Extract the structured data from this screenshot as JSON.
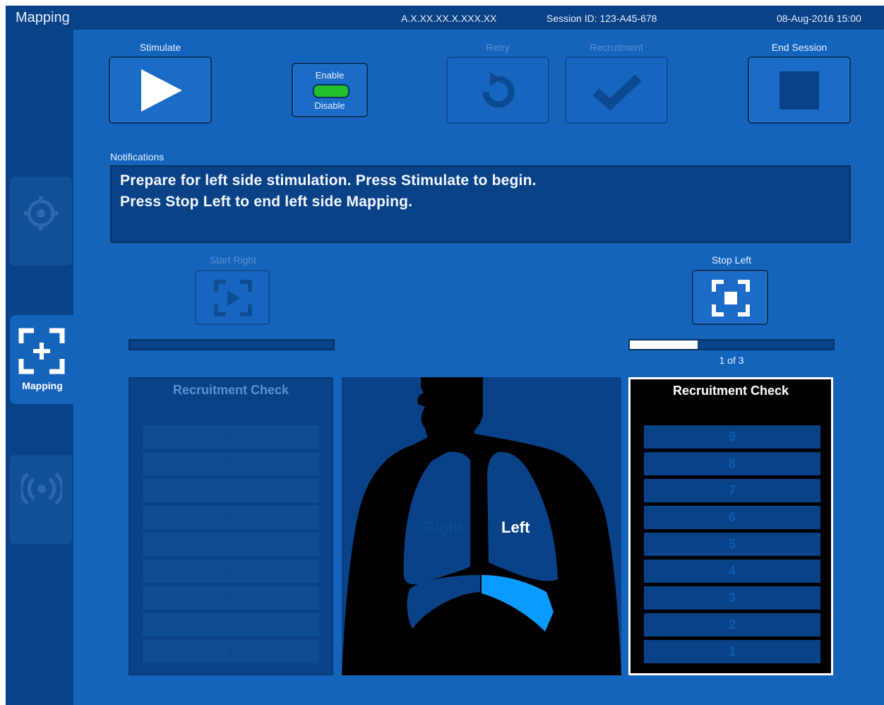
{
  "header": {
    "title": "Mapping",
    "device_id": "A.X.XX.XX.X.XXX.XX",
    "session": "Session ID: 123-A45-678",
    "datetime": "08-Aug-2016 15:00"
  },
  "sidebar": {
    "items": [
      {
        "label": "",
        "icon": "target-icon",
        "state": "disabled"
      },
      {
        "label": "Mapping",
        "icon": "mapping-icon",
        "state": "active"
      },
      {
        "label": "",
        "icon": "signal-icon",
        "state": "disabled"
      }
    ]
  },
  "toolbar": {
    "stimulate_label": "Stimulate",
    "enable_label": "Enable",
    "disable_label": "Disable",
    "retry_label": "Retry",
    "recruitment_label": "Recruitment",
    "end_session_label": "End Session"
  },
  "notifications": {
    "label": "Notifications",
    "lines": [
      "Prepare for left side stimulation. Press Stimulate to begin.",
      "Press Stop Left to end left side Mapping."
    ]
  },
  "controls": {
    "start_right_label": "Start Right",
    "stop_left_label": "Stop Left",
    "left_progress_text": "1 of 3",
    "left_progress_fraction": 0.333,
    "right_progress_fraction": 0
  },
  "recruitment": {
    "title": "Recruitment Check",
    "levels": [
      "9",
      "8",
      "7",
      "6",
      "5",
      "4",
      "3",
      "2",
      "1"
    ]
  },
  "body": {
    "right_label": "Right",
    "left_label": "Left"
  },
  "colors": {
    "background": "#1564bc",
    "header": "#0a4288",
    "accent_green": "#22c02a",
    "highlight_blue": "#0a9bff"
  }
}
